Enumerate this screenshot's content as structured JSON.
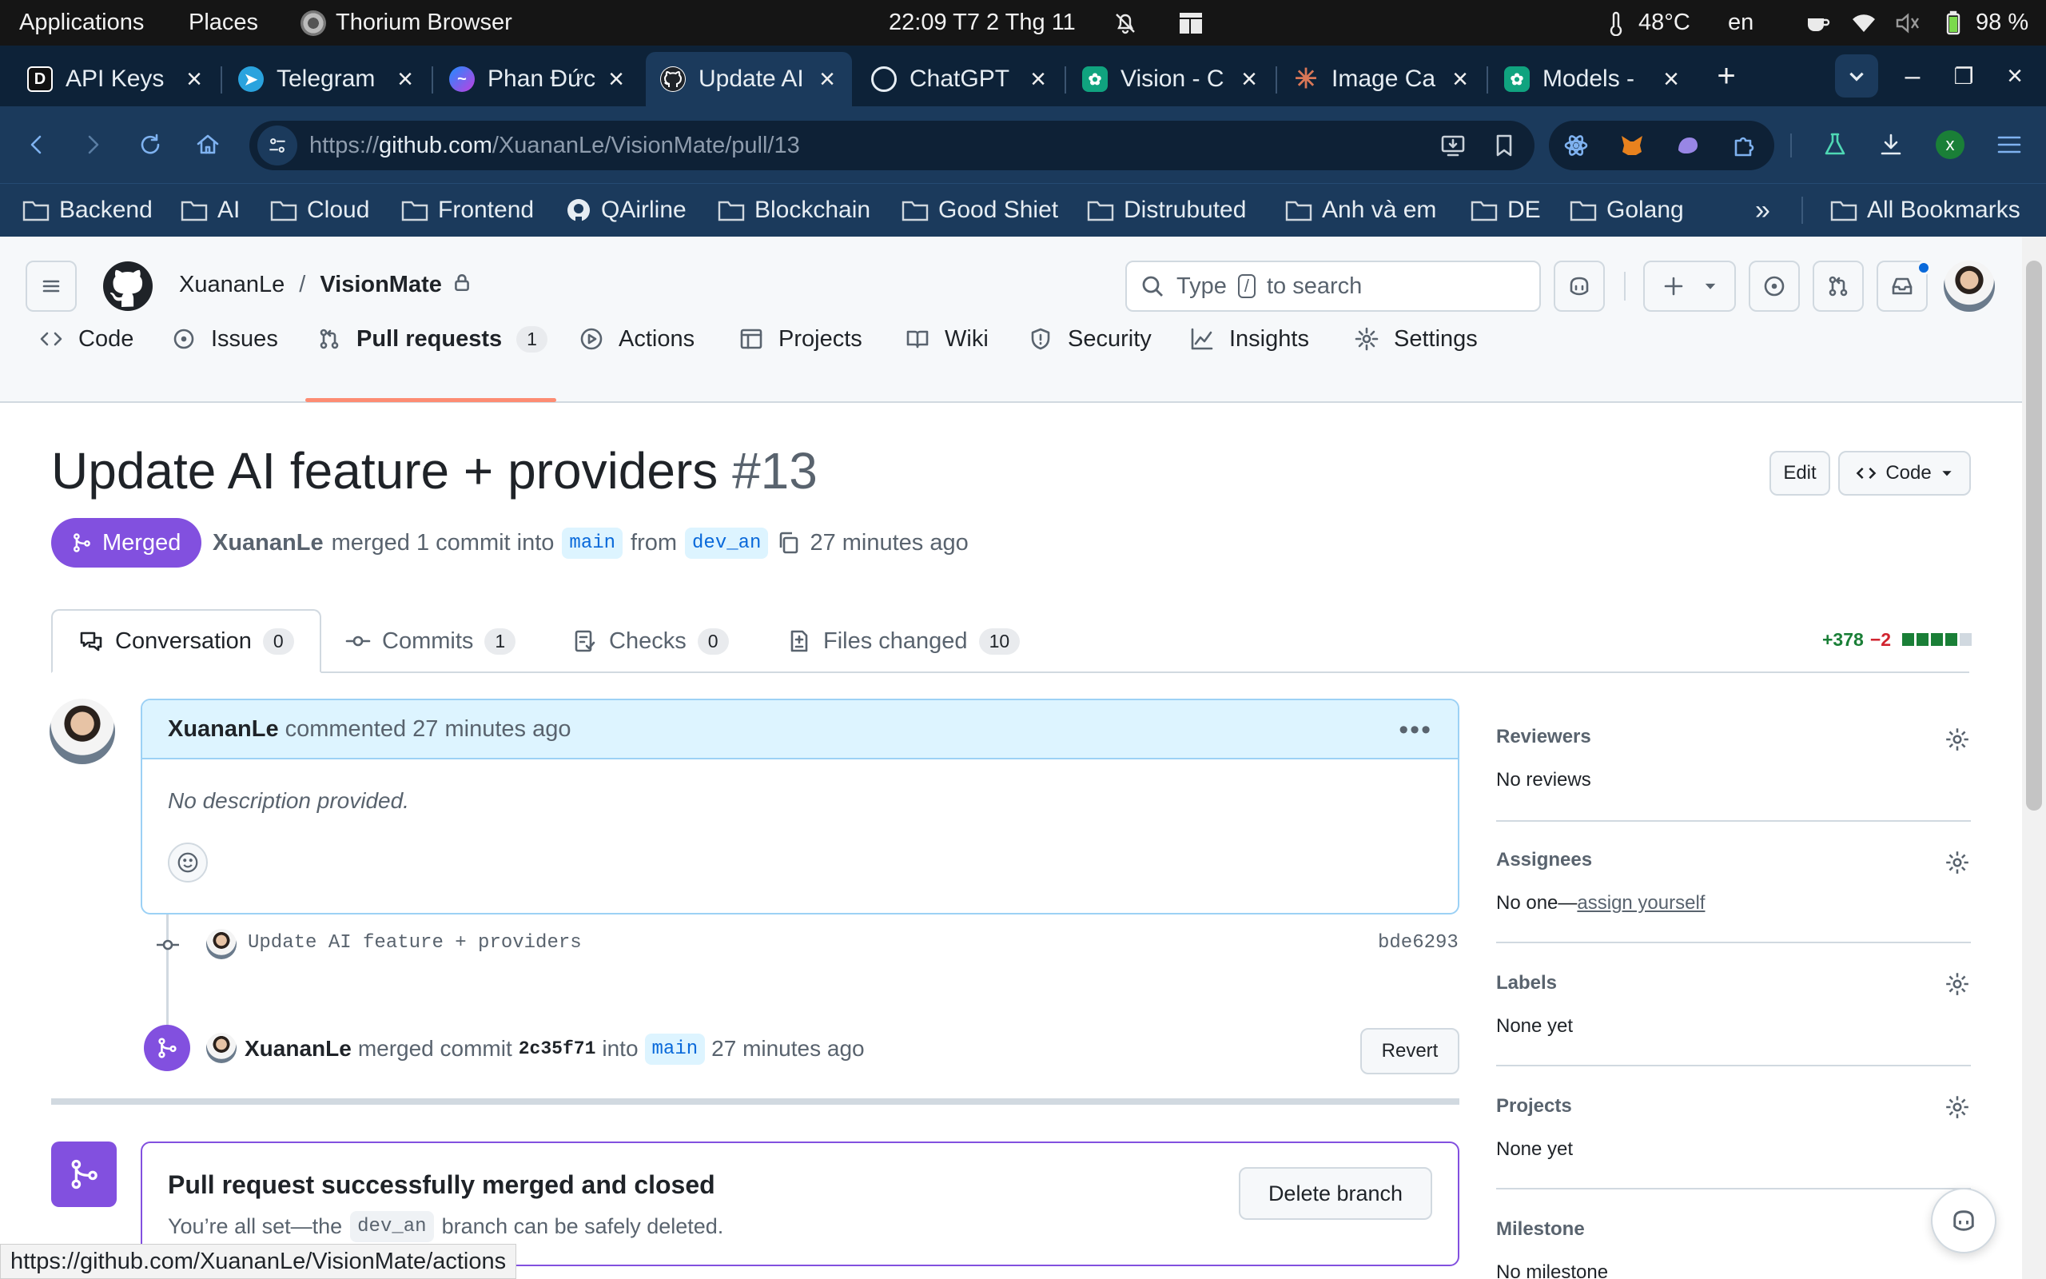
{
  "os": {
    "applications": "Applications",
    "places": "Places",
    "browser_name": "Thorium Browser",
    "clock": "22:09  T7 2 Thg 11",
    "temperature": "48°C",
    "lang": "en",
    "battery": "98 %"
  },
  "tabs": [
    {
      "title": "API Keys",
      "favicon": "D",
      "color": "#111111"
    },
    {
      "title": "Telegram",
      "favicon": "T",
      "color": "#2aa3de"
    },
    {
      "title": "Phan Đức",
      "favicon": "M",
      "color": "#a24cf1"
    },
    {
      "title": "Update AI",
      "favicon": "G",
      "color": "#1f2328"
    },
    {
      "title": "ChatGPT",
      "favicon": "C",
      "color": "#222222"
    },
    {
      "title": "Vision - C",
      "favicon": "V",
      "color": "#10a37f"
    },
    {
      "title": "Image Ca",
      "favicon": "*",
      "color": "#d97757"
    },
    {
      "title": "Models -",
      "favicon": "M",
      "color": "#10a37f"
    }
  ],
  "address": {
    "scheme": "https://",
    "host": "github.com",
    "path": "/XuananLe/VisionMate/pull/13"
  },
  "extension_avatar_letter": "x",
  "bookmarks": [
    "Backend",
    "AI",
    "Cloud",
    "Frontend",
    "QAirline",
    "Blockchain",
    "Good Shiet",
    "Distrubuted",
    "Anh và em",
    "DE",
    "Golang"
  ],
  "all_bookmarks": "All Bookmarks",
  "overflow": "»",
  "repo": {
    "owner": "XuananLe",
    "separator": "/",
    "name": "VisionMate"
  },
  "search": {
    "prefix": "Type",
    "key": "/",
    "suffix": "to search"
  },
  "nav": [
    {
      "label": "Code",
      "icon": "code-icon"
    },
    {
      "label": "Issues",
      "icon": "issue-icon"
    },
    {
      "label": "Pull requests",
      "icon": "pull-request-icon",
      "count": "1",
      "selected": true
    },
    {
      "label": "Actions",
      "icon": "play-icon"
    },
    {
      "label": "Projects",
      "icon": "table-icon"
    },
    {
      "label": "Wiki",
      "icon": "book-icon"
    },
    {
      "label": "Security",
      "icon": "shield-icon"
    },
    {
      "label": "Insights",
      "icon": "graph-icon"
    },
    {
      "label": "Settings",
      "icon": "gear-icon"
    }
  ],
  "pr": {
    "title": "Update AI feature + providers",
    "number": "#13",
    "edit_label": "Edit",
    "code_label": "Code",
    "status": "Merged",
    "author": "XuananLe",
    "merged_text": "merged 1 commit into",
    "base": "main",
    "from_text": "from",
    "head": "dev_an",
    "time": "27 minutes ago"
  },
  "pr_tabs": [
    {
      "label": "Conversation",
      "count": "0"
    },
    {
      "label": "Commits",
      "count": "1"
    },
    {
      "label": "Checks",
      "count": "0"
    },
    {
      "label": "Files changed",
      "count": "10"
    }
  ],
  "diffstat": {
    "added": "+378",
    "removed": "−2"
  },
  "comment": {
    "author": "XuananLe",
    "action": "commented 27 minutes ago",
    "body": "No description provided."
  },
  "commit": {
    "message": "Update AI feature + providers",
    "sha": "bde6293"
  },
  "merge_event": {
    "author": "XuananLe",
    "text": "merged commit",
    "sha": "2c35f71",
    "into": "into",
    "branch": "main",
    "time": "27 minutes ago",
    "revert_label": "Revert"
  },
  "merge_box": {
    "title": "Pull request successfully merged and closed",
    "text_before": "You’re all set—the",
    "branch": "dev_an",
    "text_after": "branch can be safely deleted.",
    "delete_label": "Delete branch"
  },
  "sidebar": {
    "reviewers": {
      "heading": "Reviewers",
      "value": "No reviews"
    },
    "assignees": {
      "heading": "Assignees",
      "value": "No one—",
      "link": "assign yourself"
    },
    "labels": {
      "heading": "Labels",
      "value": "None yet"
    },
    "projects": {
      "heading": "Projects",
      "value": "None yet"
    },
    "milestone": {
      "heading": "Milestone",
      "value": "No milestone"
    }
  },
  "status_url": "https://github.com/XuananLe/VisionMate/actions",
  "colors": {
    "merged": "#8250df",
    "accent": "#fd8c73",
    "added": "#1a7f37",
    "removed": "#d1242f"
  }
}
